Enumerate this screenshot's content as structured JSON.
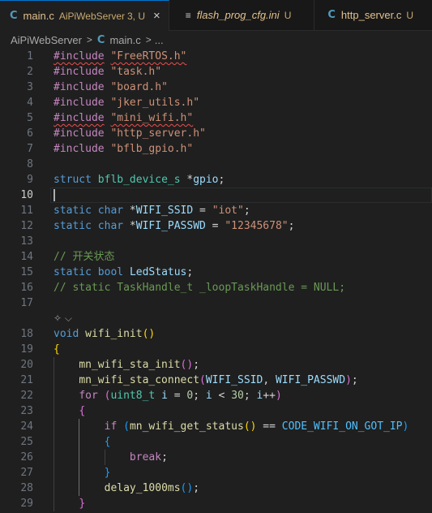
{
  "colors": {
    "accent": "#0078d4",
    "modified": "#e2c08d",
    "c_icon": "#519aba",
    "error": "#f14c4c"
  },
  "tabs": [
    {
      "icon": "c-file-icon",
      "icon_glyph": "C",
      "name": "main.c",
      "description": "AiPiWebServer",
      "status": "3, U",
      "active": true,
      "close": "×"
    },
    {
      "icon": "settings-file-icon",
      "icon_glyph": "≡",
      "name": "flash_prog_cfg.ini",
      "status": "U",
      "active": false
    },
    {
      "icon": "c-file-icon",
      "icon_glyph": "C",
      "name": "http_server.c",
      "status": "U",
      "active": false
    }
  ],
  "breadcrumb": {
    "folder": "AiPiWebServer",
    "sep": ">",
    "file_icon": "C",
    "file": "main.c",
    "more": "..."
  },
  "editor": {
    "current_line": "10",
    "code_lens_icon": "copilot-sparkle-icon",
    "code_lens_glyph": "✧",
    "code_lens_chevron": "⌵",
    "lines": [
      {
        "n": "1",
        "tokens": [
          [
            "pp",
            "#include"
          ],
          [
            "p",
            " "
          ],
          [
            "str",
            "\"FreeRTOS.h\""
          ]
        ],
        "squiggle": true
      },
      {
        "n": "2",
        "tokens": [
          [
            "pp",
            "#include"
          ],
          [
            "p",
            " "
          ],
          [
            "str",
            "\"task.h\""
          ]
        ]
      },
      {
        "n": "3",
        "tokens": [
          [
            "pp",
            "#include"
          ],
          [
            "p",
            " "
          ],
          [
            "str",
            "\"board.h\""
          ]
        ]
      },
      {
        "n": "4",
        "tokens": [
          [
            "pp",
            "#include"
          ],
          [
            "p",
            " "
          ],
          [
            "str",
            "\"jker_utils.h\""
          ]
        ]
      },
      {
        "n": "5",
        "tokens": [
          [
            "pp",
            "#include"
          ],
          [
            "p",
            " "
          ],
          [
            "str",
            "\"mini_wifi.h\""
          ]
        ],
        "squiggle": true
      },
      {
        "n": "6",
        "tokens": [
          [
            "pp",
            "#include"
          ],
          [
            "p",
            " "
          ],
          [
            "str",
            "\"http_server.h\""
          ]
        ]
      },
      {
        "n": "7",
        "tokens": [
          [
            "pp",
            "#include"
          ],
          [
            "p",
            " "
          ],
          [
            "str",
            "\"bflb_gpio.h\""
          ]
        ]
      },
      {
        "n": "8",
        "tokens": []
      },
      {
        "n": "9",
        "tokens": [
          [
            "kw",
            "struct"
          ],
          [
            "p",
            " "
          ],
          [
            "type",
            "bflb_device_s"
          ],
          [
            "p",
            " *"
          ],
          [
            "var",
            "gpio"
          ],
          [
            "p",
            ";"
          ]
        ]
      },
      {
        "n": "10",
        "tokens": []
      },
      {
        "n": "11",
        "tokens": [
          [
            "kw",
            "static"
          ],
          [
            "p",
            " "
          ],
          [
            "kw",
            "char"
          ],
          [
            "p",
            " *"
          ],
          [
            "var",
            "WIFI_SSID"
          ],
          [
            "p",
            " = "
          ],
          [
            "str",
            "\"iot\""
          ],
          [
            "p",
            ";"
          ]
        ]
      },
      {
        "n": "12",
        "tokens": [
          [
            "kw",
            "static"
          ],
          [
            "p",
            " "
          ],
          [
            "kw",
            "char"
          ],
          [
            "p",
            " *"
          ],
          [
            "var",
            "WIFI_PASSWD"
          ],
          [
            "p",
            " = "
          ],
          [
            "str",
            "\"12345678\""
          ],
          [
            "p",
            ";"
          ]
        ]
      },
      {
        "n": "13",
        "tokens": []
      },
      {
        "n": "14",
        "tokens": [
          [
            "com",
            "// 开关状态"
          ]
        ]
      },
      {
        "n": "15",
        "tokens": [
          [
            "kw",
            "static"
          ],
          [
            "p",
            " "
          ],
          [
            "kw",
            "bool"
          ],
          [
            "p",
            " "
          ],
          [
            "var",
            "LedStatus"
          ],
          [
            "p",
            ";"
          ]
        ]
      },
      {
        "n": "16",
        "tokens": [
          [
            "com",
            "// static TaskHandle_t _loopTaskHandle = NULL;"
          ]
        ]
      },
      {
        "n": "17",
        "tokens": []
      },
      {
        "n": "18",
        "tokens": [
          [
            "kw",
            "void"
          ],
          [
            "p",
            " "
          ],
          [
            "fn",
            "wifi_init"
          ],
          [
            "b1",
            "()"
          ]
        ]
      },
      {
        "n": "19",
        "tokens": [
          [
            "b1",
            "{"
          ]
        ]
      },
      {
        "n": "20",
        "tokens": [
          [
            "p",
            "    "
          ],
          [
            "fn",
            "mn_wifi_sta_init"
          ],
          [
            "b2",
            "()"
          ],
          [
            "p",
            ";"
          ]
        ]
      },
      {
        "n": "21",
        "tokens": [
          [
            "p",
            "    "
          ],
          [
            "fn",
            "mn_wifi_sta_connect"
          ],
          [
            "b2",
            "("
          ],
          [
            "var",
            "WIFI_SSID"
          ],
          [
            "p",
            ", "
          ],
          [
            "var",
            "WIFI_PASSWD"
          ],
          [
            "b2",
            ")"
          ],
          [
            "p",
            ";"
          ]
        ]
      },
      {
        "n": "22",
        "tokens": [
          [
            "p",
            "    "
          ],
          [
            "ctrl",
            "for"
          ],
          [
            "p",
            " "
          ],
          [
            "b2",
            "("
          ],
          [
            "type",
            "uint8_t"
          ],
          [
            "p",
            " "
          ],
          [
            "var",
            "i"
          ],
          [
            "p",
            " = "
          ],
          [
            "num",
            "0"
          ],
          [
            "p",
            "; "
          ],
          [
            "var",
            "i"
          ],
          [
            "p",
            " < "
          ],
          [
            "num",
            "30"
          ],
          [
            "p",
            "; "
          ],
          [
            "var",
            "i"
          ],
          [
            "p",
            "++"
          ],
          [
            "b2",
            ")"
          ]
        ]
      },
      {
        "n": "23",
        "tokens": [
          [
            "p",
            "    "
          ],
          [
            "b2",
            "{"
          ]
        ]
      },
      {
        "n": "24",
        "tokens": [
          [
            "p",
            "        "
          ],
          [
            "ctrl",
            "if"
          ],
          [
            "p",
            " "
          ],
          [
            "b3",
            "("
          ],
          [
            "fn",
            "mn_wifi_get_status"
          ],
          [
            "b1",
            "()"
          ],
          [
            "p",
            " == "
          ],
          [
            "macro",
            "CODE_WIFI_ON_GOT_IP"
          ],
          [
            "b3",
            ")"
          ]
        ]
      },
      {
        "n": "25",
        "tokens": [
          [
            "p",
            "        "
          ],
          [
            "b3",
            "{"
          ]
        ]
      },
      {
        "n": "26",
        "tokens": [
          [
            "p",
            "            "
          ],
          [
            "ctrl",
            "break"
          ],
          [
            "p",
            ";"
          ]
        ]
      },
      {
        "n": "27",
        "tokens": [
          [
            "p",
            "        "
          ],
          [
            "b3",
            "}"
          ]
        ]
      },
      {
        "n": "28",
        "tokens": [
          [
            "p",
            "        "
          ],
          [
            "fn",
            "delay_1000ms"
          ],
          [
            "b3",
            "()"
          ],
          [
            "p",
            ";"
          ]
        ]
      },
      {
        "n": "29",
        "tokens": [
          [
            "p",
            "    "
          ],
          [
            "b2",
            "}"
          ]
        ]
      }
    ]
  }
}
